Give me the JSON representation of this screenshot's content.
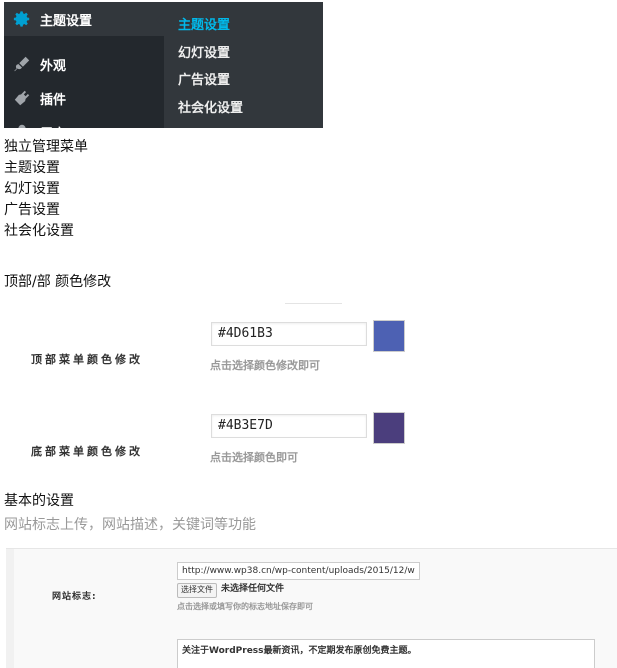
{
  "admin_menu": {
    "items": [
      {
        "label": "主题设置",
        "icon": "gear-icon",
        "current": true
      },
      {
        "label": "外观",
        "icon": "brush-icon"
      },
      {
        "label": "插件",
        "icon": "plug-icon"
      },
      {
        "label": "用户",
        "icon": "user-icon"
      }
    ],
    "submenu": [
      {
        "label": "主题设置",
        "active": true
      },
      {
        "label": "幻灯设置"
      },
      {
        "label": "广告设置"
      },
      {
        "label": "社会化设置"
      }
    ],
    "colors": {
      "background": "#23282d",
      "current_bg": "#32373c",
      "accent": "#00b9eb"
    }
  },
  "text_lines": {
    "standalone_menu": "独立管理菜单",
    "menu_items": [
      "主题设置",
      "幻灯设置",
      "广告设置",
      "社会化设置"
    ],
    "color_section_title": "顶部/部 颜色修改"
  },
  "color_settings": [
    {
      "label": "顶部菜单颜色修改",
      "value": "#4D61B3",
      "swatch": "#4d61b3",
      "hint": "点击选择颜色修改即可"
    },
    {
      "label": "底部菜单颜色修改",
      "value": "#4B3E7D",
      "swatch": "#4b3e7d",
      "hint": "点击选择颜色即可"
    }
  ],
  "basic_section": {
    "title": "基本的设置",
    "subtitle": "网站标志上传，网站描述，关键词等功能",
    "logo_label": "网站标志:",
    "logo_url": "http://www.wp38.cn/wp-content/uploads/2015/12/w",
    "file_button": "选择文件",
    "file_status": "未选择任何文件",
    "logo_hint": "点击选择或填写你的标志地址保存即可",
    "description": "关注于WordPress最新资讯，不定期发布原创免费主题。"
  }
}
